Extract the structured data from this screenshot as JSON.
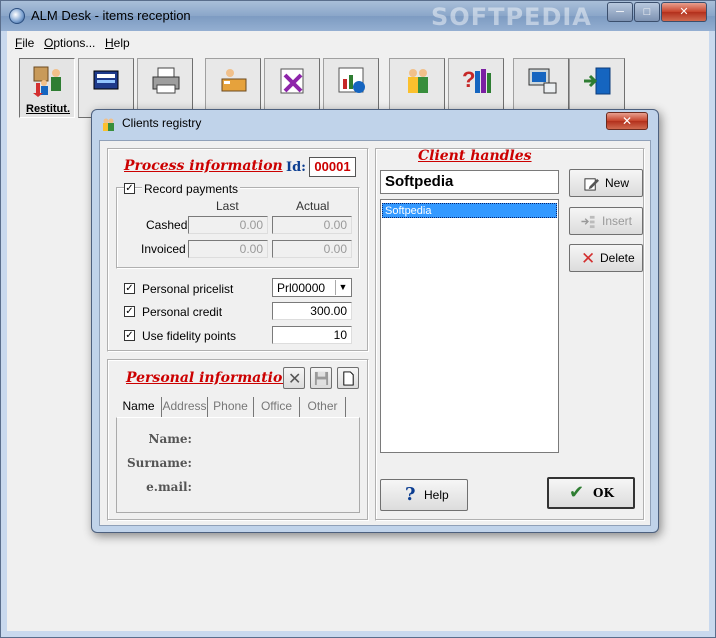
{
  "window": {
    "title": "ALM Desk - items reception",
    "watermark": "SOFTPEDIA"
  },
  "menu": [
    {
      "label": "File",
      "accel": "F",
      "rest": "ile"
    },
    {
      "label": "Options...",
      "accel": "O",
      "rest": "ptions..."
    },
    {
      "label": "Help",
      "accel": "H",
      "rest": "elp"
    }
  ],
  "toolbar": {
    "active_label": "Restitut."
  },
  "dialog": {
    "title": "Clients registry",
    "process": {
      "title": "Process information",
      "id_label": "Id:",
      "id_value": "00001",
      "record_payments": "Record payments",
      "col_last": "Last",
      "col_actual": "Actual",
      "cashed_label": "Cashed",
      "cashed_last": "0.00",
      "cashed_actual": "0.00",
      "invoiced_label": "Invoiced",
      "invoiced_last": "0.00",
      "invoiced_actual": "0.00",
      "pricelist_label": "Personal pricelist",
      "pricelist_value": "Prl00000",
      "credit_label": "Personal credit",
      "credit_value": "300.00",
      "fidelity_label": "Use fidelity points",
      "fidelity_value": "10"
    },
    "personal": {
      "title": "Personal information",
      "tabs": [
        "Name",
        "Address",
        "Phone",
        "Office",
        "Other"
      ],
      "name_label": "Name:",
      "surname_label": "Surname:",
      "email_label": "e.mail:"
    },
    "handles": {
      "title": "Client handles",
      "input_value": "Softpedia",
      "list": [
        "Softpedia"
      ]
    },
    "buttons": {
      "new": "New",
      "insert": "Insert",
      "delete": "Delete",
      "help": "Help",
      "ok": "OK"
    }
  },
  "colors": {
    "accent_red": "#cc0000",
    "selection": "#3399ff"
  }
}
